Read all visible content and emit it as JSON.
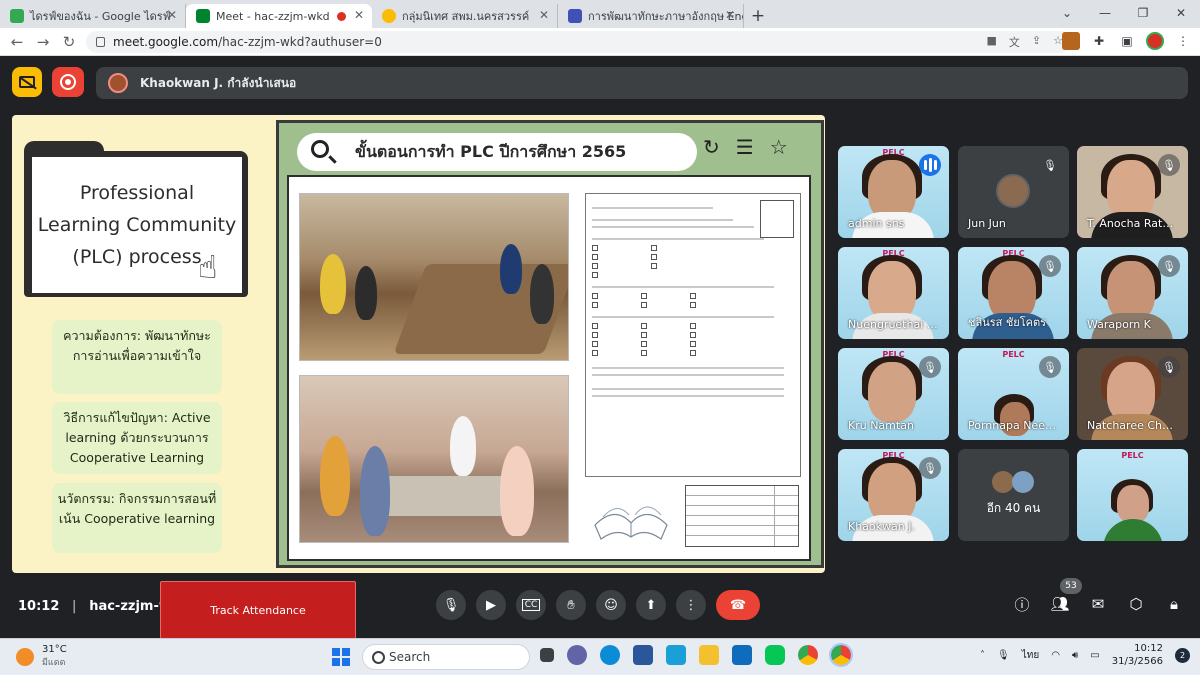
{
  "browser": {
    "tabs": [
      {
        "title": "ไดรฟ์ของฉัน - Google ไดรฟ์",
        "favicon_color": "#34a853",
        "active": false
      },
      {
        "title": "Meet - hac-zzjm-wkd",
        "favicon_color": "#00832d",
        "active": true,
        "recording": true
      },
      {
        "title": "กลุ่มนิเทศ สพม.นครสวรรค์",
        "favicon_color": "#fbbc04",
        "active": false
      },
      {
        "title": "การพัฒนาทักษะภาษาอังกฤษ English",
        "favicon_color": "#3f51b5",
        "active": false
      }
    ],
    "url_host": "meet.google.com",
    "url_path": "/hac-zzjm-wkd?authuser=0"
  },
  "meet": {
    "presenter_banner": "Khaokwan J. กำลังนำเสนอ",
    "slide": {
      "folder_title": "Professional Learning Community (PLC) process",
      "bubble1": "ความต้องการ: พัฒนาทักษะการอ่านเพื่อความเข้าใจ",
      "bubble2": "วิธีการแก้ไขปัญหา: Active learning ด้วยกระบวนการ Cooperative Learning",
      "bubble3": "นวัตกรรม: กิจกรรมการสอนที่เน้น Cooperative learning",
      "search_text": "ขั้นตอนการทำ PLC ปีการศึกษา 2565"
    },
    "participants": [
      {
        "name": "admin sns",
        "muted": false,
        "speaking": true,
        "video": "slide"
      },
      {
        "name": "Jun Jun",
        "muted": true,
        "video": "avatar"
      },
      {
        "name": "T. Anocha Rat…",
        "muted": true,
        "video": "camera"
      },
      {
        "name": "Nuengruethai …",
        "muted": false,
        "video": "camera"
      },
      {
        "name": "ชลินรส ชัยโคตร",
        "muted": true,
        "video": "camera"
      },
      {
        "name": "Waraporn K",
        "muted": true,
        "video": "camera"
      },
      {
        "name": "Kru Namtan",
        "muted": true,
        "video": "camera"
      },
      {
        "name": "Pornnapa Nee…",
        "muted": true,
        "video": "camera"
      },
      {
        "name": "Natcharee Ch…",
        "muted": true,
        "video": "camera"
      },
      {
        "name": "Khaokwan J.",
        "muted": true,
        "video": "camera"
      },
      {
        "name": "อีก 40 คน",
        "muted": false,
        "video": "others"
      },
      {
        "name": "",
        "muted": false,
        "video": "screen"
      }
    ],
    "bottom": {
      "time": "10:12",
      "meeting_code": "hac-zzjm-wkd",
      "track_attendance": "Track Attendance",
      "people_count": "53"
    }
  },
  "taskbar": {
    "temperature": "31°C",
    "weather": "มีแดด",
    "search_placeholder": "Search",
    "language": "ไทย",
    "clock_time": "10:12",
    "clock_date": "31/3/2566",
    "notifications": "2"
  }
}
